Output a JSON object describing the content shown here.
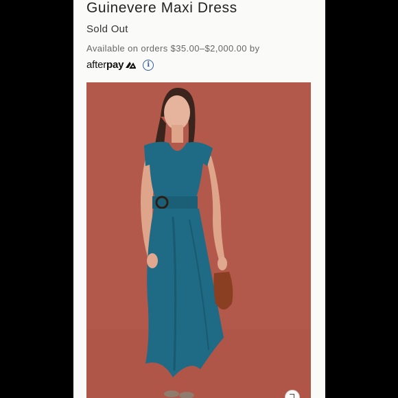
{
  "product": {
    "title": "Guinevere Maxi Dress",
    "status": "Sold Out",
    "availability_text": "Available on orders $35.00–$2,000.00 by"
  },
  "afterpay": {
    "brand_light": "after",
    "brand_bold": "pay",
    "logo_icon": "afterpay-arrows-icon",
    "info_icon": "info-icon"
  },
  "colors": {
    "photo_background": "#b3594c",
    "dress": "#1f6a84",
    "info_icon": "#2b5a9e"
  }
}
